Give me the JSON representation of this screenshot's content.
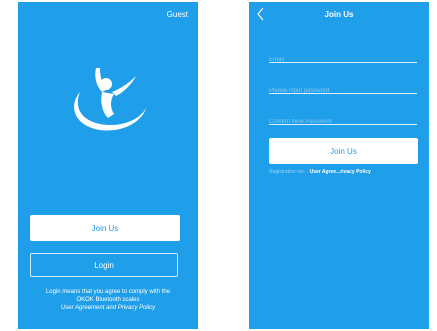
{
  "login_screen": {
    "guest_label": "Guest",
    "join_button_label": "Join Us",
    "login_button_label": "Login",
    "legal_line1": "Login means that you agree to comply with the",
    "legal_line2": "OKOK Bluetooth scales",
    "legal_link": "User Agreement and Privacy Policy"
  },
  "join_screen": {
    "title": "Join Us",
    "email_placeholder": "Email",
    "password_placeholder": "Please input password",
    "confirm_placeholder": "Confirm New Password",
    "submit_label": "Join Us",
    "registration_note": "Registration me...",
    "registration_link": "User Agree...rivacy Policy"
  },
  "colors": {
    "background_blue": "#1f9ee9",
    "button_white": "#ffffff"
  },
  "icons": {
    "logo": "person-jumping-logo-icon",
    "back": "chevron-left-icon"
  }
}
